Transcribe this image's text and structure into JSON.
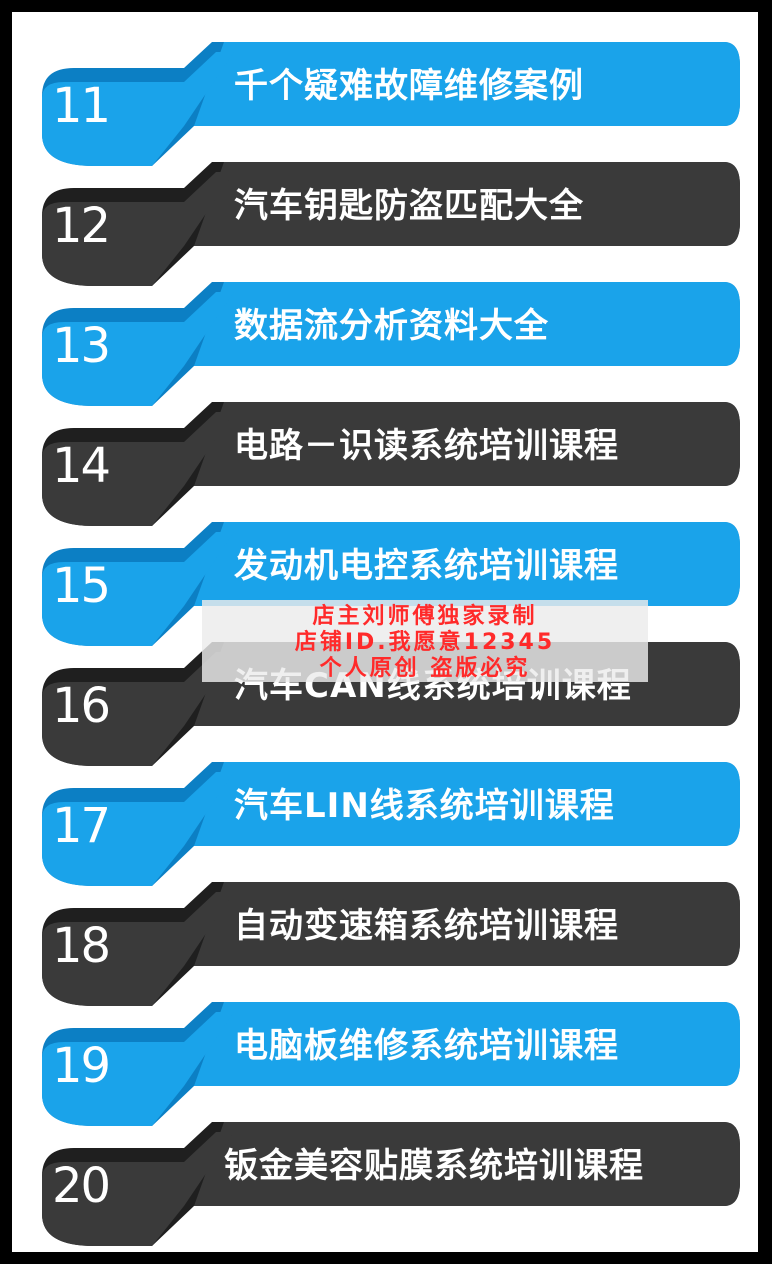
{
  "colors": {
    "blue_main": "#1aa3ea",
    "blue_dark": "#0c7fc4",
    "dark_main": "#3a3a3a",
    "dark_shade": "#1f1f1f"
  },
  "items": [
    {
      "number": "11",
      "label": "千个疑难故障维修案例",
      "theme": "blue"
    },
    {
      "number": "12",
      "label": "汽车钥匙防盗匹配大全",
      "theme": "dark"
    },
    {
      "number": "13",
      "label": "数据流分析资料大全",
      "theme": "blue"
    },
    {
      "number": "14",
      "label": "电路－识读系统培训课程",
      "theme": "dark"
    },
    {
      "number": "15",
      "label": "发动机电控系统培训课程",
      "theme": "blue"
    },
    {
      "number": "16",
      "label": "汽车CAN线系统培训课程",
      "theme": "dark"
    },
    {
      "number": "17",
      "label": "汽车LIN线系统培训课程",
      "theme": "blue"
    },
    {
      "number": "18",
      "label": "自动变速箱系统培训课程",
      "theme": "dark"
    },
    {
      "number": "19",
      "label": "电脑板维修系统培训课程",
      "theme": "blue"
    },
    {
      "number": "20",
      "label": "钣金美容贴膜系统培训课程",
      "theme": "dark"
    }
  ],
  "watermark": {
    "line1": "店主刘师傅独家录制",
    "line2": "店铺ID.我愿意12345",
    "line3": "个人原创  盗版必究"
  }
}
